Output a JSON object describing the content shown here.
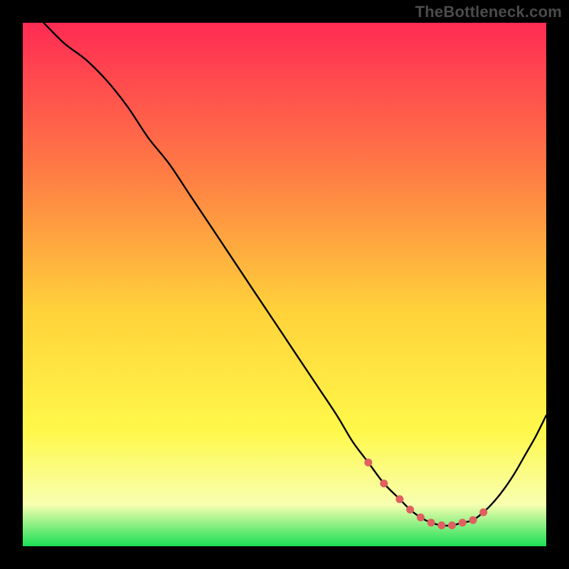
{
  "watermark": "TheBottleneck.com",
  "colors": {
    "bg": "#000000",
    "gradient_top": "#ff2b54",
    "gradient_mid_upper": "#ff7a45",
    "gradient_mid": "#ffd23a",
    "gradient_mid_lower": "#fff84a",
    "gradient_lower": "#f8ffb0",
    "gradient_bottom": "#1adf55",
    "curve": "#000000",
    "dots": "#e06060"
  },
  "chart_data": {
    "type": "line",
    "title": "",
    "xlabel": "",
    "ylabel": "",
    "xlim": [
      0,
      100
    ],
    "ylim": [
      0,
      100
    ],
    "grid": false,
    "legend": null,
    "series": [
      {
        "name": "bottleneck-curve",
        "x": [
          4,
          8,
          12,
          16,
          20,
          24,
          28,
          32,
          36,
          40,
          44,
          48,
          52,
          56,
          60,
          63,
          66,
          69,
          72,
          74,
          76,
          78,
          80,
          82,
          84,
          86,
          88,
          90,
          92,
          94,
          96,
          98,
          100
        ],
        "y": [
          100,
          96,
          93,
          89,
          84,
          78,
          73,
          67,
          61,
          55,
          49,
          43,
          37,
          31,
          25,
          20,
          16,
          12,
          9,
          7,
          5.5,
          4.5,
          4,
          4,
          4.5,
          5,
          6.5,
          8.5,
          11,
          14,
          17.5,
          21,
          25
        ]
      }
    ],
    "highlight_points": {
      "name": "optimal-range-dots",
      "x": [
        66,
        69,
        72,
        74,
        76,
        78,
        80,
        82,
        84,
        86,
        88
      ],
      "y": [
        16,
        12,
        9,
        7,
        5.5,
        4.5,
        4,
        4,
        4.5,
        5,
        6.5
      ]
    }
  }
}
